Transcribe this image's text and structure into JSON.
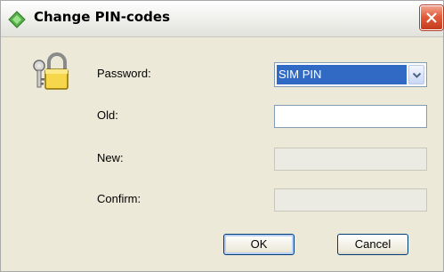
{
  "window": {
    "title": "Change PIN-codes",
    "icon": "diamond-app-icon",
    "close_icon": "close-icon"
  },
  "form": {
    "lock_icon": "lock-keys-icon",
    "password_label": "Password:",
    "password_selected": "SIM PIN",
    "old_label": "Old:",
    "old_value": "",
    "new_label": "New:",
    "new_value": "",
    "confirm_label": "Confirm:",
    "confirm_value": ""
  },
  "buttons": {
    "ok_label": "OK",
    "cancel_label": "Cancel"
  },
  "colors": {
    "selection": "#316ac5",
    "close_button": "#e25c3b",
    "dialog_bg": "#ece9d8"
  }
}
